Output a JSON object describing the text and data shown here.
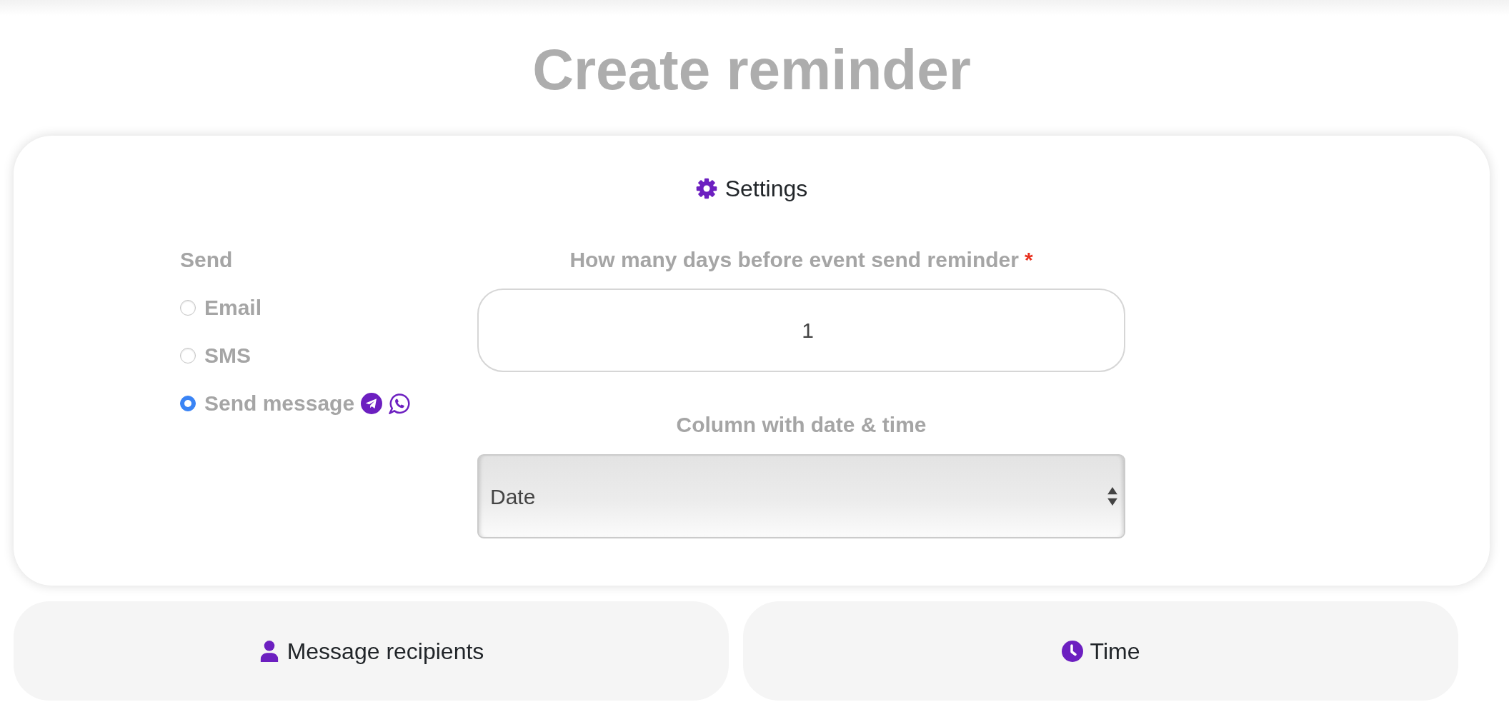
{
  "page": {
    "title": "Create reminder"
  },
  "settings": {
    "title": "Settings",
    "send": {
      "label": "Send",
      "options": [
        {
          "kind": "plain",
          "label": "Email",
          "selected": false
        },
        {
          "kind": "plain",
          "label": "SMS",
          "selected": false
        },
        {
          "kind": "messenger",
          "label": "Send message",
          "selected": true
        }
      ]
    },
    "days_before": {
      "label": "How many days before event send reminder",
      "required_mark": "*",
      "value": "1"
    },
    "date_column": {
      "label": "Column with date & time",
      "value": "Date"
    }
  },
  "sections": [
    {
      "kind": "recipients",
      "title": "Message recipients"
    },
    {
      "kind": "time",
      "title": "Time"
    }
  ]
}
